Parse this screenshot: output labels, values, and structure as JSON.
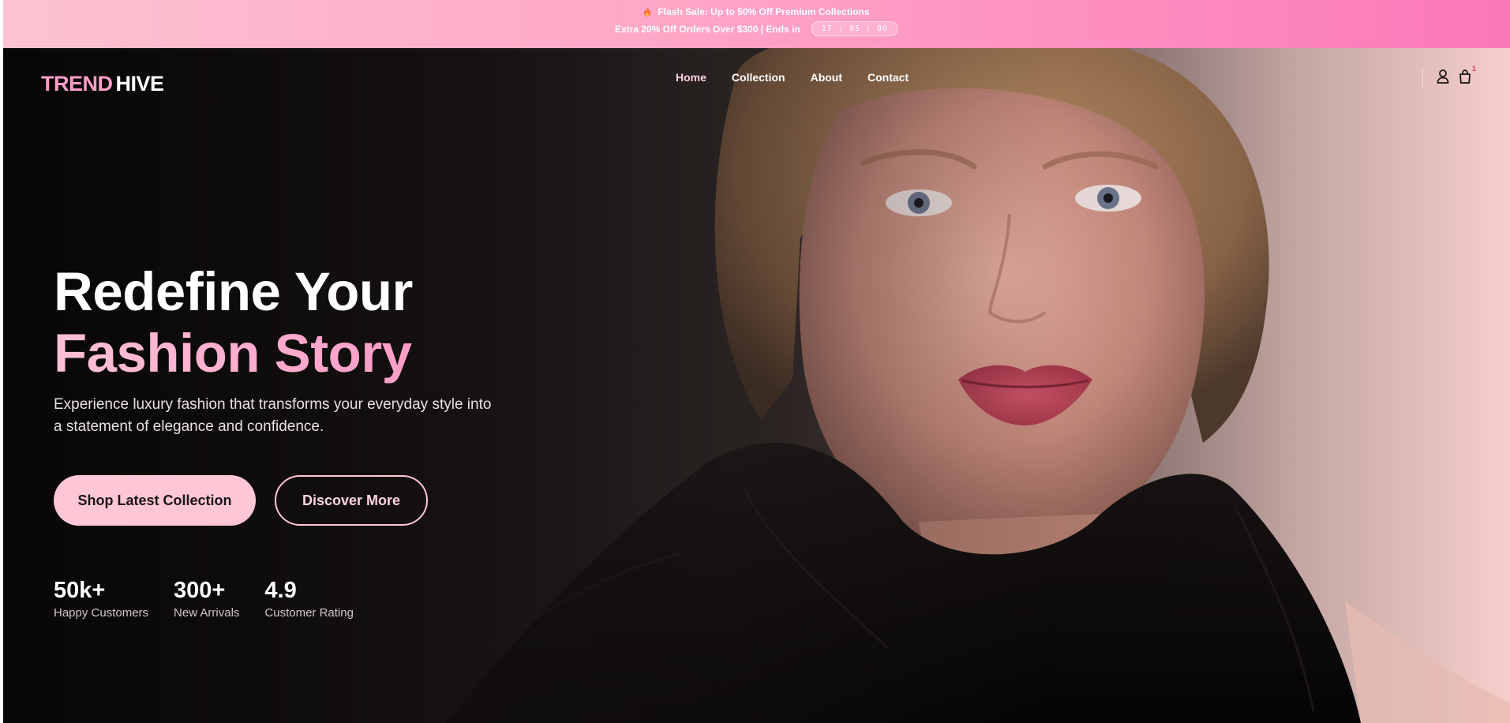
{
  "promo": {
    "line1": "Flash Sale: Up to 50% Off Premium Collections",
    "line2": "Extra 20% Off Orders Over $300 | Ends in",
    "timer": "17 : 05 : 06",
    "fire_icon": "fire-icon"
  },
  "brand": {
    "part1": "TREND",
    "part2": "HIVE"
  },
  "nav": {
    "links": [
      {
        "label": "Home",
        "active": true
      },
      {
        "label": "Collection"
      },
      {
        "label": "About"
      },
      {
        "label": "Contact"
      }
    ],
    "user_icon": "user-icon",
    "cart_icon": "shopping-bag-icon",
    "cart_count": "1"
  },
  "hero": {
    "title_line1": "Redefine Your",
    "title_line2": "Fashion Story",
    "subtitle": "Experience luxury fashion that transforms your everyday style into a statement of elegance and confidence.",
    "primary_button": "Shop Latest Collection",
    "secondary_button": "Discover More",
    "stats": [
      {
        "value": "50k+",
        "label": "Happy Customers"
      },
      {
        "value": "300+",
        "label": "New Arrivals"
      },
      {
        "value": "4.9",
        "label": "Customer Rating"
      }
    ]
  },
  "colors": {
    "accent_pink": "#ff9ec8",
    "button_pink": "#ffc6d6",
    "dark": "#0a0808"
  }
}
